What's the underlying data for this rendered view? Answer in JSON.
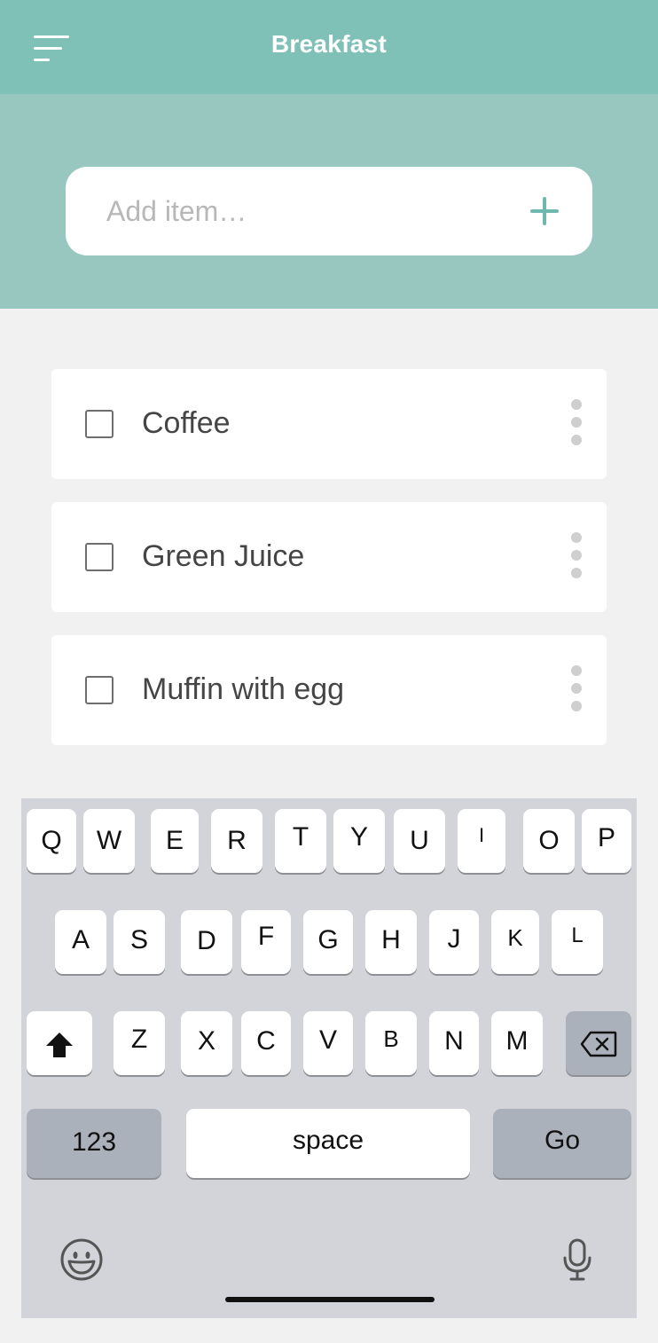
{
  "header": {
    "title": "Breakfast",
    "menu_icon": "menu-icon"
  },
  "add_item": {
    "placeholder": "Add item…",
    "value": "",
    "add_icon": "plus-icon",
    "accent": "#6fb8ad"
  },
  "list": {
    "items": [
      {
        "label": "Coffee",
        "checked": false
      },
      {
        "label": "Green Juice",
        "checked": false
      },
      {
        "label": "Muffin with egg",
        "checked": false
      }
    ],
    "more_icon": "more-vertical-icon"
  },
  "colors": {
    "header": "#80c1b7",
    "band": "#97c7bf",
    "background": "#f1f1f1"
  },
  "keyboard": {
    "row1": [
      "Q",
      "W",
      "E",
      "R",
      "T",
      "Y",
      "U",
      "I",
      "O",
      "P"
    ],
    "row2": [
      "A",
      "S",
      "D",
      "F",
      "G",
      "H",
      "J",
      "K",
      "L"
    ],
    "row3": [
      "Z",
      "X",
      "C",
      "V",
      "B",
      "N",
      "M"
    ],
    "numbers_label": "123",
    "space_label": "space",
    "go_label": "Go",
    "shift_icon": "shift-icon",
    "backspace_icon": "backspace-icon",
    "emoji_icon": "emoji-icon",
    "mic_icon": "microphone-icon"
  }
}
